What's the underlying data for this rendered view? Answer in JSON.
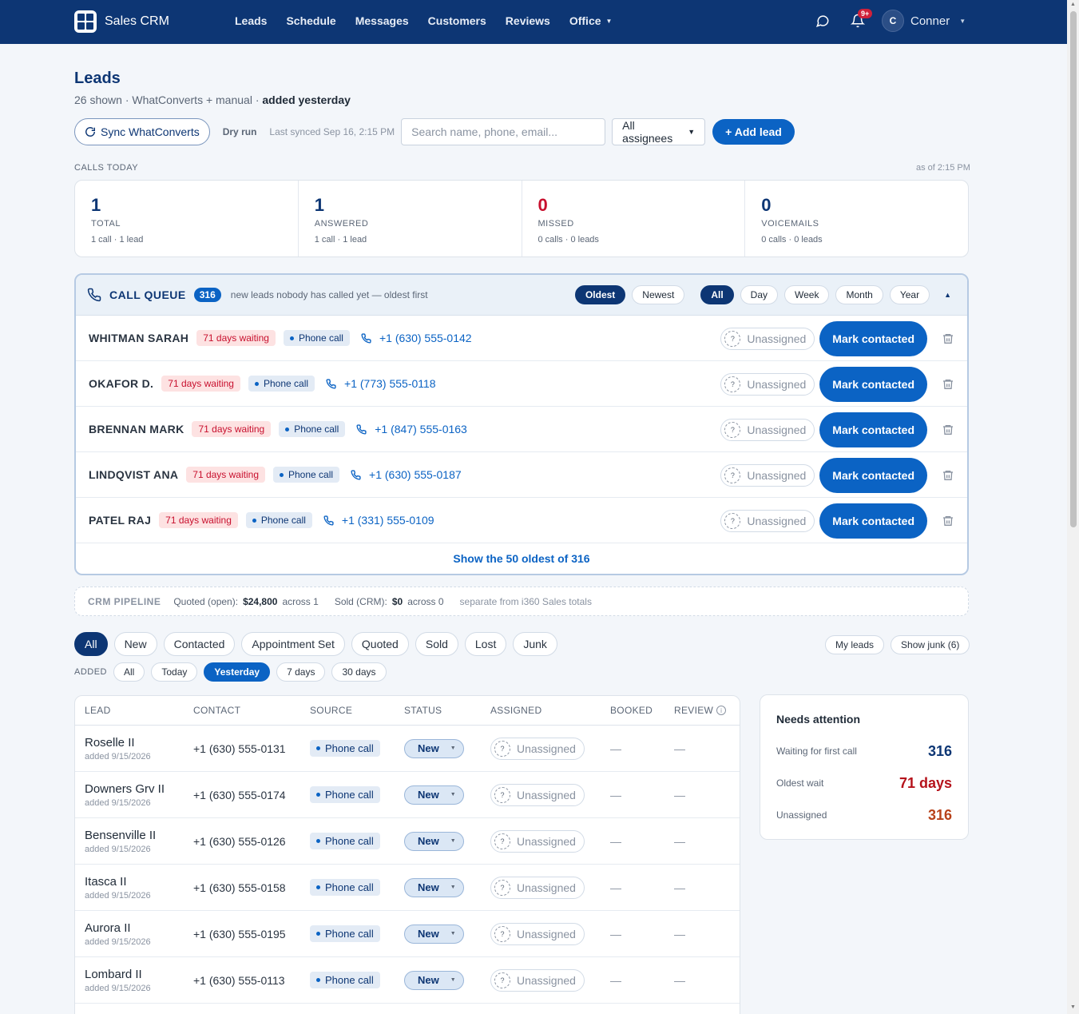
{
  "nav": {
    "brand": "Sales CRM",
    "links": [
      "Leads",
      "Schedule",
      "Messages",
      "Customers",
      "Reviews",
      "Office"
    ],
    "notif_badge": "9+",
    "user_initial": "C",
    "user_name": "Conner",
    "icons": {
      "chat": "chat-bubble-icon",
      "bell": "bell-icon"
    }
  },
  "header": {
    "title": "Leads",
    "subtitle_plain": "26 shown · WhatConverts + manual · ",
    "subtitle_bold": "added yesterday",
    "sync_button": "Sync WhatConverts",
    "dry_run": "Dry run",
    "last_synced": "Last synced Sep 16, 2:15 PM",
    "search_placeholder": "Search name, phone, email...",
    "assignee_select": "All assignees",
    "add_lead": "+ Add lead"
  },
  "calls_today": {
    "label": "CALLS TODAY",
    "as_of": "as of 2:15 PM",
    "stats": [
      {
        "value": "1",
        "label": "TOTAL",
        "sub": "1 call · 1 lead",
        "color": "#0d3674"
      },
      {
        "value": "1",
        "label": "ANSWERED",
        "sub": "1 call · 1 lead",
        "color": "#0d3674"
      },
      {
        "value": "0",
        "label": "MISSED",
        "sub": "0 calls · 0 leads",
        "color": "#c8102e"
      },
      {
        "value": "0",
        "label": "VOICEMAILS",
        "sub": "0 calls · 0 leads",
        "color": "#0d3674"
      }
    ]
  },
  "queue": {
    "title": "CALL QUEUE",
    "count": "316",
    "description": "new leads nobody has called yet — oldest first",
    "order_filters": [
      "Oldest",
      "Newest"
    ],
    "order_active": "Oldest",
    "range_filters": [
      "All",
      "Day",
      "Week",
      "Month",
      "Year"
    ],
    "range_active": "All",
    "rows": [
      {
        "name": "WHITMAN SARAH",
        "wait": "71 days waiting",
        "source": "Phone call",
        "phone": "+1 (630) 555-0142",
        "assignee": "Unassigned",
        "action": "Mark contacted"
      },
      {
        "name": "OKAFOR D.",
        "wait": "71 days waiting",
        "source": "Phone call",
        "phone": "+1 (773) 555-0118",
        "assignee": "Unassigned",
        "action": "Mark contacted"
      },
      {
        "name": "BRENNAN MARK",
        "wait": "71 days waiting",
        "source": "Phone call",
        "phone": "+1 (847) 555-0163",
        "assignee": "Unassigned",
        "action": "Mark contacted"
      },
      {
        "name": "LINDQVIST ANA",
        "wait": "71 days waiting",
        "source": "Phone call",
        "phone": "+1 (630) 555-0187",
        "assignee": "Unassigned",
        "action": "Mark contacted"
      },
      {
        "name": "PATEL RAJ",
        "wait": "71 days waiting",
        "source": "Phone call",
        "phone": "+1 (331) 555-0109",
        "assignee": "Unassigned",
        "action": "Mark contacted"
      }
    ],
    "show_more": "Show the 50 oldest of 316"
  },
  "pipeline": {
    "label": "CRM PIPELINE",
    "quoted_label": "Quoted (open):",
    "quoted_value": "$24,800",
    "quoted_across": "across 1",
    "sold_label": "Sold (CRM):",
    "sold_value": "$0",
    "sold_across": "across 0",
    "note": "separate from i360 Sales totals"
  },
  "status_filters": [
    "All",
    "New",
    "Contacted",
    "Appointment Set",
    "Quoted",
    "Sold",
    "Lost",
    "Junk"
  ],
  "status_active": "All",
  "right_filters": [
    "My leads",
    "Show junk (6)"
  ],
  "added": {
    "label": "ADDED",
    "options": [
      "All",
      "Today",
      "Yesterday",
      "7 days",
      "30 days"
    ],
    "active": "Yesterday"
  },
  "table": {
    "columns": [
      "LEAD",
      "CONTACT",
      "SOURCE",
      "STATUS",
      "ASSIGNED",
      "BOOKED",
      "REVIEW"
    ],
    "rows": [
      {
        "name": "Roselle II",
        "added": "added 9/15/2026",
        "phone": "+1 (630) 555-0131",
        "source": "Phone call",
        "status": "New",
        "assigned": "Unassigned",
        "booked": "—",
        "review": "—"
      },
      {
        "name": "Downers Grv II",
        "added": "added 9/15/2026",
        "phone": "+1 (630) 555-0174",
        "source": "Phone call",
        "status": "New",
        "assigned": "Unassigned",
        "booked": "—",
        "review": "—"
      },
      {
        "name": "Bensenville II",
        "added": "added 9/15/2026",
        "phone": "+1 (630) 555-0126",
        "source": "Phone call",
        "status": "New",
        "assigned": "Unassigned",
        "booked": "—",
        "review": "—"
      },
      {
        "name": "Itasca II",
        "added": "added 9/15/2026",
        "phone": "+1 (630) 555-0158",
        "source": "Phone call",
        "status": "New",
        "assigned": "Unassigned",
        "booked": "—",
        "review": "—"
      },
      {
        "name": "Aurora II",
        "added": "added 9/15/2026",
        "phone": "+1 (630) 555-0195",
        "source": "Phone call",
        "status": "New",
        "assigned": "Unassigned",
        "booked": "—",
        "review": "—"
      },
      {
        "name": "Lombard II",
        "added": "added 9/15/2026",
        "phone": "+1 (630) 555-0113",
        "source": "Phone call",
        "status": "New",
        "assigned": "Unassigned",
        "booked": "—",
        "review": "—"
      }
    ]
  },
  "attention": {
    "title": "Needs attention",
    "rows": [
      {
        "label": "Waiting for first call",
        "value": "316",
        "color": "#0d3674"
      },
      {
        "label": "Oldest wait",
        "value": "71 days",
        "color": "#b5121b"
      },
      {
        "label": "Unassigned",
        "value": "316",
        "color": "#b8421a"
      }
    ]
  }
}
